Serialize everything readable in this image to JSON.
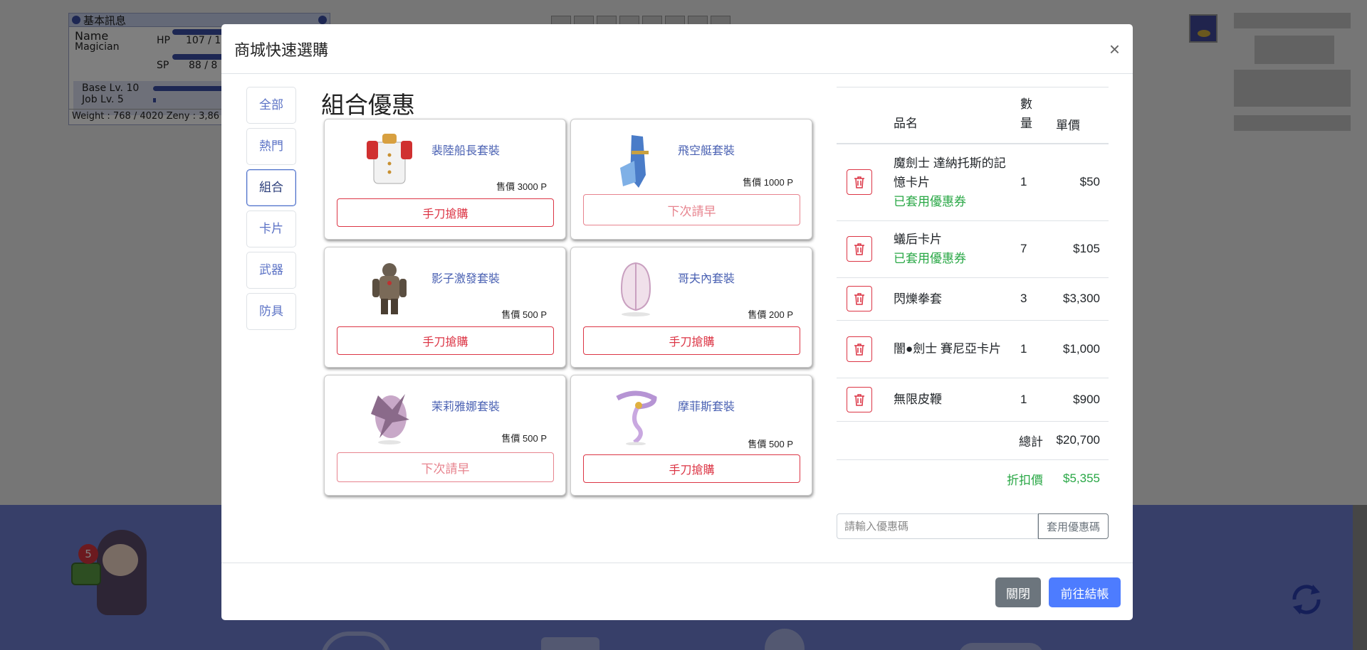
{
  "background": {
    "info_panel": {
      "title": "基本訊息",
      "name_label": "Name",
      "job_label": "Magician",
      "hp_label": "HP",
      "hp_value": "107 / 1",
      "sp_label": "SP",
      "sp_value": "88 / 8",
      "base_lv": "Base Lv. 10",
      "job_lv": "Job Lv. 5",
      "weight_zeny": "Weight : 768 / 4020   Zeny : 3,86"
    },
    "notification_count": "5"
  },
  "modal": {
    "title": "商城快速選購",
    "close_symbol": "×",
    "categories": [
      {
        "label": "全部"
      },
      {
        "label": "熱門"
      },
      {
        "label": "組合"
      },
      {
        "label": "卡片"
      },
      {
        "label": "武器"
      },
      {
        "label": "防具"
      }
    ],
    "section_title": "組合優惠",
    "products": [
      {
        "name": "裴陸船長套裝",
        "price": "售價 3000 P",
        "button": "手刀搶購"
      },
      {
        "name": "飛空艇套裝",
        "price": "售價 1000 P",
        "button": "下次請早"
      },
      {
        "name": "影子激發套裝",
        "price": "售價 500 P",
        "button": "手刀搶購"
      },
      {
        "name": "哥夫內套裝",
        "price": "售價 200 P",
        "button": "手刀搶購"
      },
      {
        "name": "茉莉雅娜套裝",
        "price": "售價 500 P",
        "button": "下次請早"
      },
      {
        "name": "摩菲斯套裝",
        "price": "售價 500 P",
        "button": "手刀搶購"
      }
    ],
    "cart": {
      "headers": {
        "name": "品名",
        "qty": "數\n量",
        "price": "單價"
      },
      "items": [
        {
          "name": "魔劍士 達納托斯的記憶卡片",
          "coupon": "已套用優惠券",
          "qty": "1",
          "price": "$50"
        },
        {
          "name": "蟻后卡片",
          "coupon": "已套用優惠券",
          "qty": "7",
          "price": "$105"
        },
        {
          "name": "閃爍拳套",
          "coupon": "",
          "qty": "3",
          "price": "$3,300"
        },
        {
          "name": "闇●劍士 賽尼亞卡片",
          "coupon": "",
          "qty": "1",
          "price": "$1,000"
        },
        {
          "name": "無限皮鞭",
          "coupon": "",
          "qty": "1",
          "price": "$900"
        }
      ],
      "total_label": "總計",
      "total_value": "$20,700",
      "discount_label": "折扣價",
      "discount_value": "$5,355"
    },
    "coupon": {
      "placeholder": "請輸入優惠碼",
      "button": "套用優惠碼"
    },
    "footer": {
      "close_label": "關閉",
      "checkout_label": "前往結帳"
    }
  },
  "colors": {
    "primary": "#4d7cff",
    "danger": "#dc3545",
    "success": "#28a745",
    "secondary": "#6c757d",
    "category_text": "#5b72c5"
  }
}
